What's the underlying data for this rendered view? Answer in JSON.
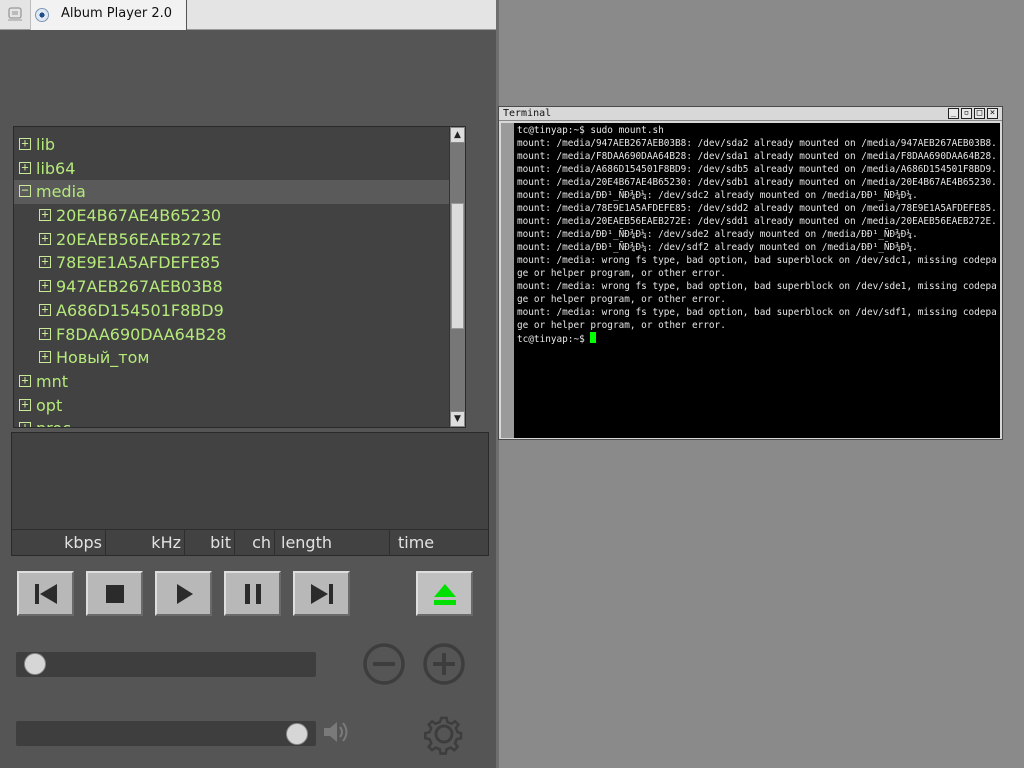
{
  "taskbar": {
    "app_title": "Album Player 2.0",
    "ghost_icon": "ghost-window-icon",
    "app_icon": "album-player-icon"
  },
  "tree": {
    "items": [
      {
        "label": "lib",
        "level": 0,
        "expanded": false
      },
      {
        "label": "lib64",
        "level": 0,
        "expanded": false
      },
      {
        "label": "media",
        "level": 0,
        "expanded": true,
        "selected": true
      },
      {
        "label": "20E4B67AE4B65230",
        "level": 1,
        "expanded": false
      },
      {
        "label": "20EAEB56EAEB272E",
        "level": 1,
        "expanded": false
      },
      {
        "label": "78E9E1A5AFDEFE85",
        "level": 1,
        "expanded": false
      },
      {
        "label": "947AEB267AEB03B8",
        "level": 1,
        "expanded": false
      },
      {
        "label": "A686D154501F8BD9",
        "level": 1,
        "expanded": false
      },
      {
        "label": "F8DAA690DAA64B28",
        "level": 1,
        "expanded": false
      },
      {
        "label": "Новый_том",
        "level": 1,
        "expanded": false
      },
      {
        "label": "mnt",
        "level": 0,
        "expanded": false
      },
      {
        "label": "opt",
        "level": 0,
        "expanded": false
      },
      {
        "label": "proc",
        "level": 0,
        "expanded": false
      }
    ]
  },
  "info": {
    "kbps": "kbps",
    "khz": "kHz",
    "bit": "bit",
    "ch": "ch",
    "length": "length",
    "time": "time"
  },
  "controls": {
    "progress": 0.03,
    "volume": 0.97,
    "eject_color": "#00e000"
  },
  "terminal": {
    "title": "Terminal",
    "lines": [
      "tc@tinyap:~$ sudo mount.sh",
      "mount: /media/947AEB267AEB03B8: /dev/sda2 already mounted on /media/947AEB267AEB03B8.",
      "mount: /media/F8DAA690DAA64B28: /dev/sda1 already mounted on /media/F8DAA690DAA64B28.",
      "mount: /media/A686D154501F8BD9: /dev/sdb5 already mounted on /media/A686D154501F8BD9.",
      "mount: /media/20E4B67AE4B65230: /dev/sdb1 already mounted on /media/20E4B67AE4B65230.",
      "mount: /media/ÐÐ¹_ÑÐ¾Ð¼: /dev/sdc2 already mounted on /media/ÐÐ¹_ÑÐ¾Ð¼.",
      "mount: /media/78E9E1A5AFDEFE85: /dev/sdd2 already mounted on /media/78E9E1A5AFDEFE85.",
      "mount: /media/20EAEB56EAEB272E: /dev/sdd1 already mounted on /media/20EAEB56EAEB272E.",
      "mount: /media/ÐÐ¹_ÑÐ¾Ð¼: /dev/sde2 already mounted on /media/ÐÐ¹_ÑÐ¾Ð¼.",
      "mount: /media/ÐÐ¹_ÑÐ¾Ð¼: /dev/sdf2 already mounted on /media/ÐÐ¹_ÑÐ¾Ð¼.",
      "mount: /media: wrong fs type, bad option, bad superblock on /dev/sdc1, missing codepage or helper program, or other error.",
      "mount: /media: wrong fs type, bad option, bad superblock on /dev/sde1, missing codepage or helper program, or other error.",
      "mount: /media: wrong fs type, bad option, bad superblock on /dev/sdf1, missing codepage or helper program, or other error."
    ],
    "prompt": "tc@tinyap:~$ "
  }
}
